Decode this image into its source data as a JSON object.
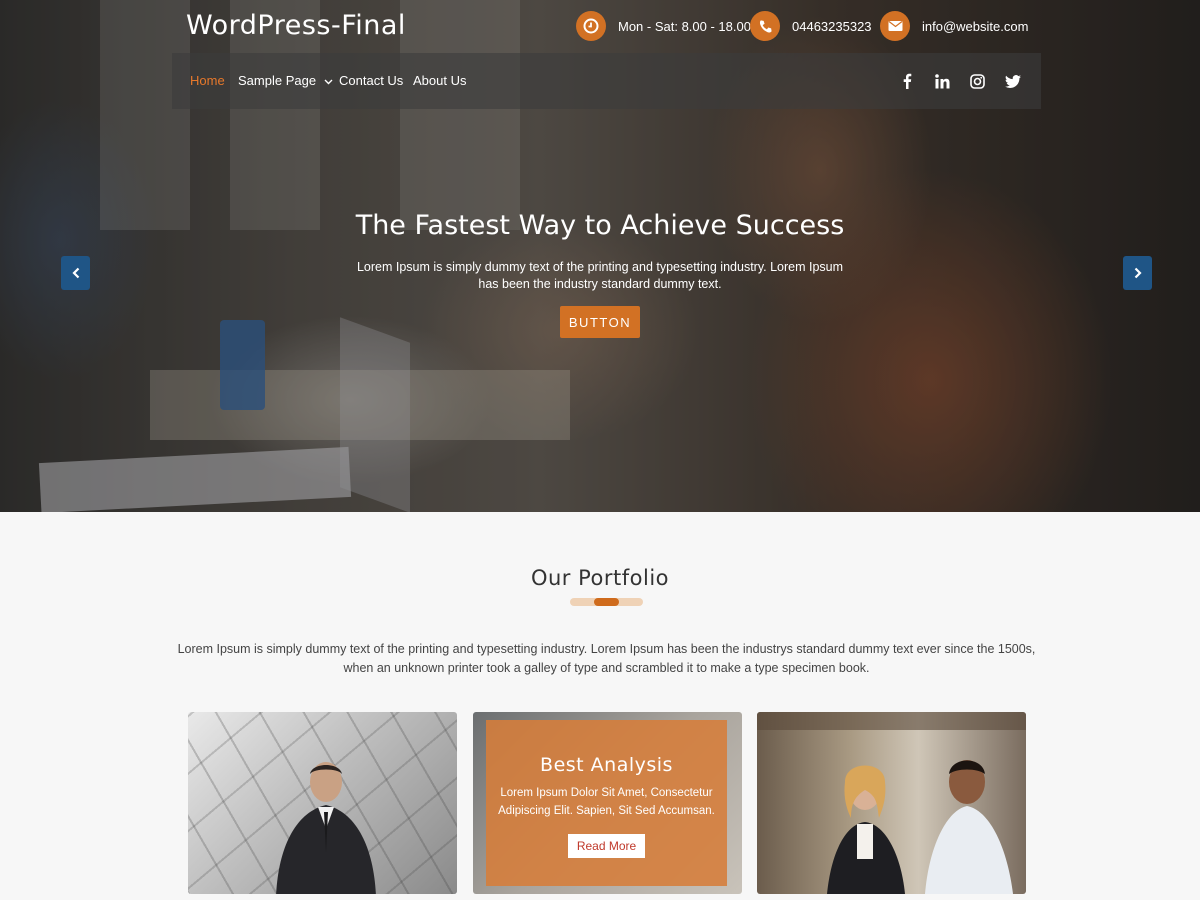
{
  "site": {
    "title": "WordPress-Final"
  },
  "topbar": {
    "hours": "Mon - Sat: 8.00 - 18.00",
    "phone": "04463235323",
    "email": "info@website.com"
  },
  "nav": {
    "home": "Home",
    "sample": "Sample Page",
    "contact": "Contact Us",
    "about": "About Us"
  },
  "social": [
    "facebook-icon",
    "linkedin-icon",
    "instagram-icon",
    "twitter-icon"
  ],
  "hero": {
    "title": "The Fastest Way to Achieve Success",
    "text": "Lorem Ipsum is simply dummy text of the printing and typesetting industry. Lorem Ipsum has been the industry standard dummy text.",
    "button": "BUTTON"
  },
  "portfolio": {
    "title": "Our Portfolio",
    "text": "Lorem Ipsum is simply dummy text of the printing and typesetting industry. Lorem Ipsum has been the industrys standard dummy text ever since the 1500s, when an unknown printer took a galley of type and scrambled it to make a type specimen book.",
    "card": {
      "title": "Best Analysis",
      "text": "Lorem Ipsum Dolor Sit Amet, Consectetur Adipiscing Elit. Sapien, Sit Sed Accumsan.",
      "button": "Read More"
    }
  },
  "colors": {
    "accent": "#d27124",
    "arrow": "#1f5586"
  }
}
